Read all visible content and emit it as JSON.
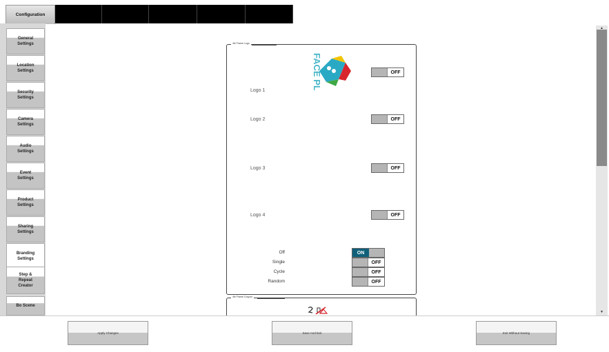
{
  "tabs": {
    "active_label": "Configuration"
  },
  "sidebar": {
    "items": [
      {
        "label": "General Settings"
      },
      {
        "label": "Location Settings"
      },
      {
        "label": "Security Settings"
      },
      {
        "label": "Camera Settings"
      },
      {
        "label": "Audio Settings"
      },
      {
        "label": "Event Settings"
      },
      {
        "label": "Product Settings"
      },
      {
        "label": "Sharing Settings"
      },
      {
        "label": "Branding Settings"
      },
      {
        "label": "Step & Repeat Creator"
      },
      {
        "label": "Bo Scene"
      }
    ]
  },
  "panel": {
    "legend": "4th Frame Logo",
    "logo_image_text": "FACE PLACE",
    "logos": [
      {
        "label": "Logo 1",
        "state": "OFF"
      },
      {
        "label": "Logo 2",
        "state": "OFF"
      },
      {
        "label": "Logo 3",
        "state": "OFF"
      },
      {
        "label": "Logo 4",
        "state": "OFF"
      }
    ],
    "modes": [
      {
        "label": "Off",
        "state": "ON"
      },
      {
        "label": "Single",
        "state": "OFF"
      },
      {
        "label": "Cycle",
        "state": "OFF"
      },
      {
        "label": "Random",
        "state": "OFF"
      }
    ]
  },
  "panel2": {
    "legend": "4th Frame Coupon"
  },
  "bottom": {
    "apply": "Apply Changes",
    "save_exit": "Save And Exit",
    "exit_nosave": "Exit Without Saving"
  },
  "colors": {
    "on_toggle": "#10607a",
    "tab_black": "#000000"
  }
}
